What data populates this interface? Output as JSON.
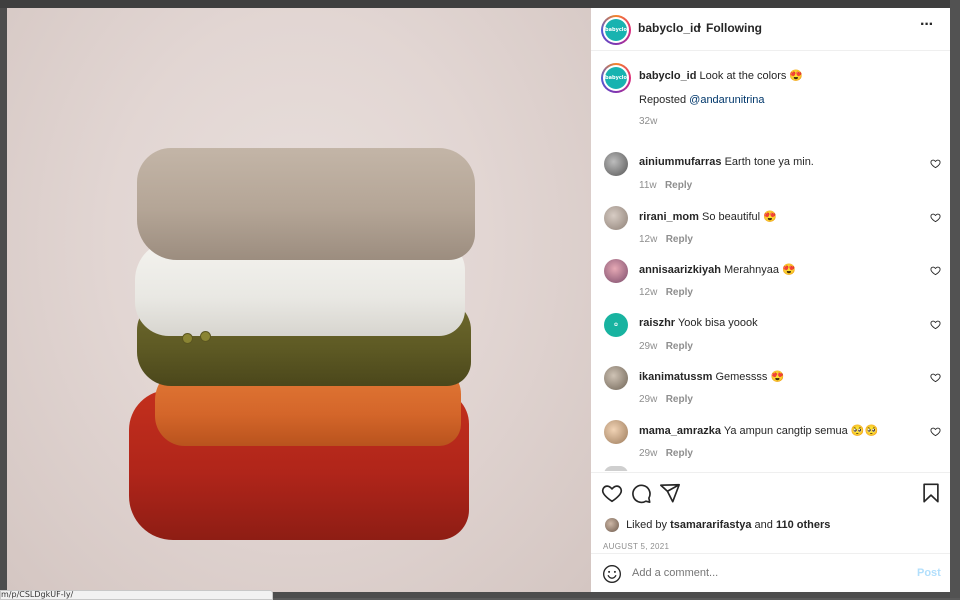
{
  "post": {
    "username": "babyclo_id",
    "follow_status": "Following",
    "avatar_text": "babyclo",
    "caption": {
      "username": "babyclo_id",
      "text": "Look at the colors 😍",
      "repost_prefix": "Reposted",
      "repost_handle": "@andarunitrina",
      "age": "32w"
    }
  },
  "comments": [
    {
      "username": "ainiummufarras",
      "text": "Earth tone ya min.",
      "age": "11w",
      "reply": "Reply",
      "avatar_color": "#6f6f6f"
    },
    {
      "username": "rirani_mom",
      "text": "So beautiful 😍",
      "age": "12w",
      "reply": "Reply",
      "avatar_color": "#9c8f86"
    },
    {
      "username": "annisaarizkiyah",
      "text": "Merahnyaa 😍",
      "age": "12w",
      "reply": "Reply",
      "avatar_color": "#b86b7a"
    },
    {
      "username": "raiszhr",
      "text": "Yook bisa yoook",
      "age": "29w",
      "reply": "Reply",
      "avatar_color": "#18b3a0"
    },
    {
      "username": "ikanimatussm",
      "text": "Gemessss 😍",
      "age": "29w",
      "reply": "Reply",
      "avatar_color": "#8a7e70"
    },
    {
      "username": "mama_amrazka",
      "text": "Ya ampun cangtip semua 🥺🥺",
      "age": "29w",
      "reply": "Reply",
      "avatar_color": "#c9a07a"
    }
  ],
  "likes": {
    "prefix": "Liked by",
    "user": "tsamararifastya",
    "and": "and",
    "others": "110 others"
  },
  "date": "AUGUST 5, 2021",
  "add_comment": {
    "placeholder": "Add a comment...",
    "post_label": "Post"
  },
  "status_bar_url": "m/p/CSLDgkUF-ly/",
  "icons": [
    "more-icon",
    "heart-icon",
    "comment-icon",
    "share-icon",
    "bookmark-icon",
    "emoji-icon"
  ],
  "colors": {
    "link": "#00376b",
    "muted": "#8e8e8e",
    "post_button": "#b2dffc",
    "brand_teal": "#18b3b0"
  }
}
